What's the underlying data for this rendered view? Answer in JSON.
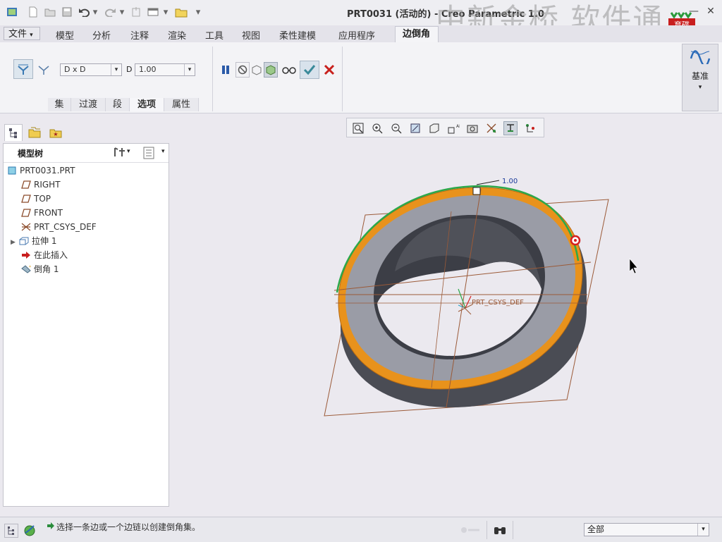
{
  "window": {
    "title": "PRT0031 (活动的) - Creo Parametric 1.0",
    "watermark": "中新金桥  软件通",
    "logo_text": "育碟软件"
  },
  "menu": {
    "file": "文件",
    "tabs": [
      "模型",
      "分析",
      "注释",
      "渲染",
      "工具",
      "视图",
      "柔性建模",
      "应用程序"
    ],
    "active_tab": "边倒角"
  },
  "ribbon": {
    "dim_scheme": "D x D",
    "d_label": "D",
    "d_value": "1.00",
    "subtabs": [
      "集",
      "过渡",
      "段",
      "选项",
      "属性"
    ],
    "datum_label": "基准"
  },
  "model_tree": {
    "title": "模型树",
    "items": [
      {
        "label": "PRT0031.PRT",
        "icon": "part-icon"
      },
      {
        "label": "RIGHT",
        "icon": "datum-plane-icon"
      },
      {
        "label": "TOP",
        "icon": "datum-plane-icon"
      },
      {
        "label": "FRONT",
        "icon": "datum-plane-icon"
      },
      {
        "label": "PRT_CSYS_DEF",
        "icon": "csys-icon"
      },
      {
        "label": "拉伸 1",
        "icon": "extrude-icon"
      },
      {
        "label": "在此插入",
        "icon": "insert-arrow-icon"
      },
      {
        "label": "倒角 1",
        "icon": "chamfer-icon"
      }
    ]
  },
  "viewport": {
    "dim_value": "1.00",
    "csys_label": "PRT_CSYS_DEF"
  },
  "status": {
    "message": "选择一条边或一个边链以创建倒角集。",
    "filter": "全部"
  },
  "colors": {
    "accent_green": "#2a8c3c",
    "cancel_red": "#c8201c",
    "chamfer_orange": "#e8921c",
    "ring_gray": "#9a9ca6",
    "datum_brown": "#8b4b2a"
  }
}
